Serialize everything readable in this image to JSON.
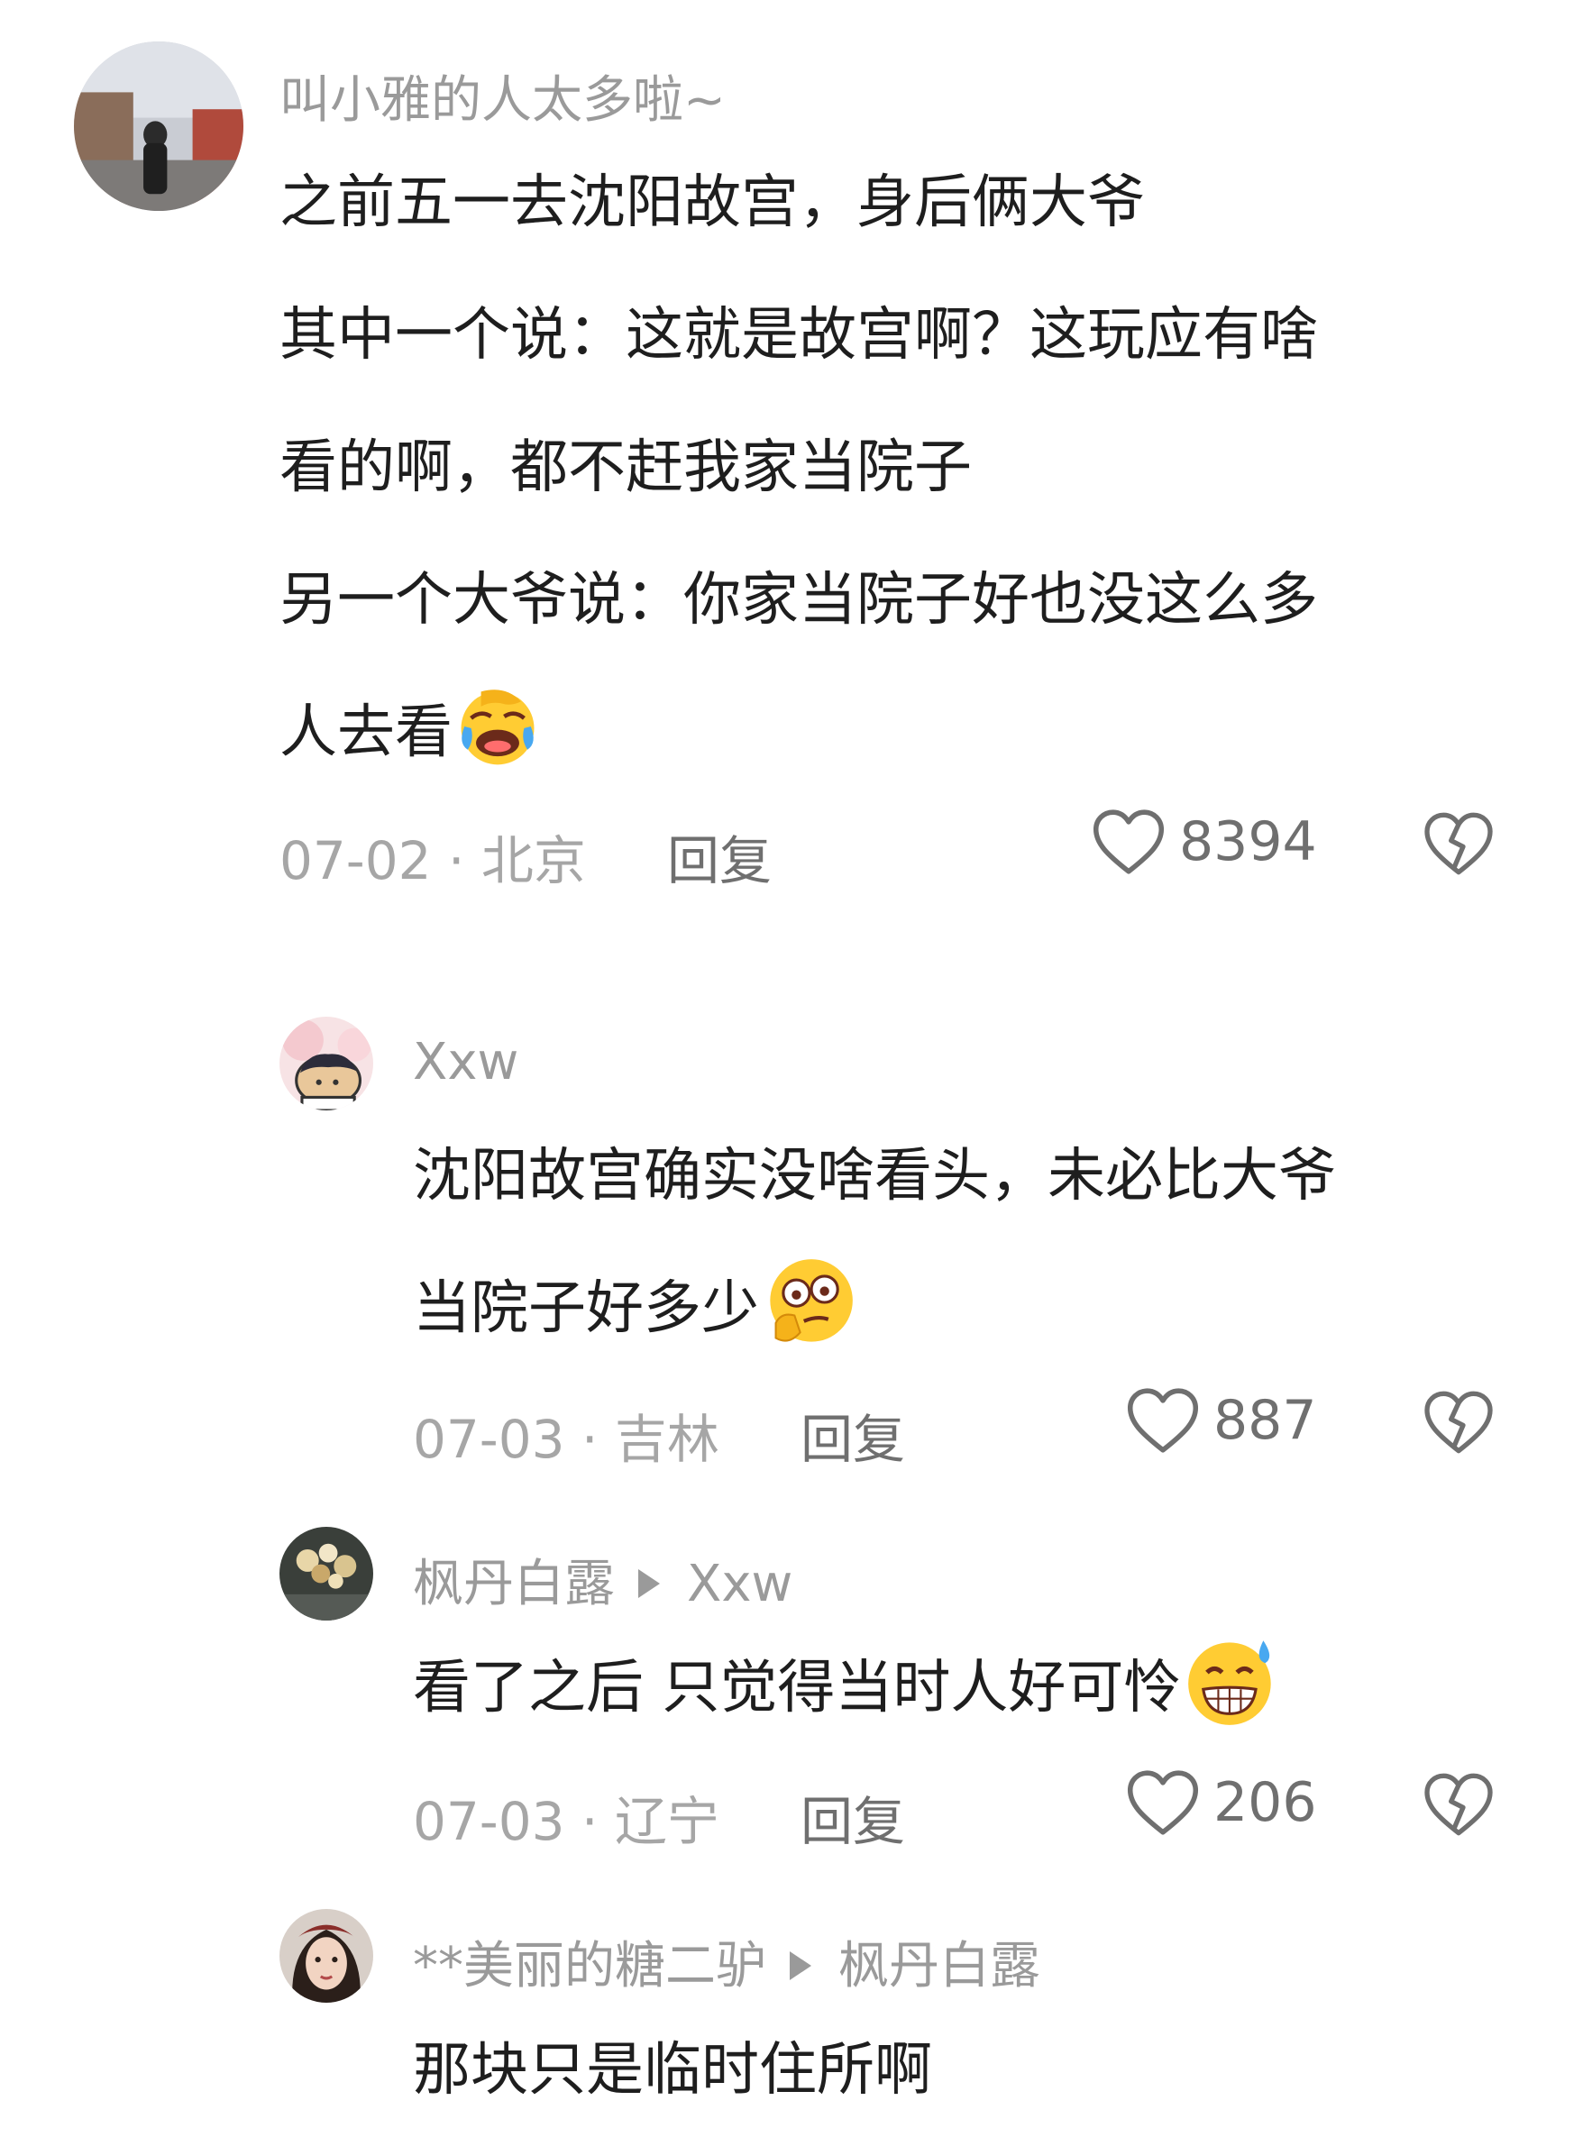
{
  "comments": [
    {
      "user": "叫小雅的人太多啦~",
      "lines": [
        "之前五一去沈阳故宫，身后俩大爷",
        "其中一个说：这就是故宫啊？这玩应有啥",
        "看的啊，都不赶我家当院子",
        "另一个大爷说：你家当院子好也没这么多",
        "人去看"
      ],
      "emoji": "face-with-hand-over-eyes-laughing",
      "date": "07-02",
      "location": "北京",
      "reply_label": "回复",
      "likes": "8394"
    },
    {
      "user": "Xxw",
      "lines": [
        "沈阳故宫确实没啥看头，未必比大爷",
        "当院子好多少"
      ],
      "emoji": "thinking-face-with-wide-eyes",
      "date": "07-03",
      "location": "吉林",
      "reply_label": "回复",
      "likes": "887"
    },
    {
      "user": "枫丹白露",
      "reply_to": "Xxw",
      "lines": [
        "看了之后 只觉得当时人好可怜"
      ],
      "emoji": "grinning-face-with-sweat",
      "date": "07-03",
      "location": "辽宁",
      "reply_label": "回复",
      "likes": "206"
    },
    {
      "user": "**美丽的糖二驴",
      "reply_to": "枫丹白露",
      "lines": [
        "那块只是临时住所啊"
      ]
    }
  ],
  "meta_separator": " · ",
  "colors": {
    "username": "#9a9a9a",
    "body": "#1e1e1e",
    "meta": "#a6a6a6",
    "action": "#6f6f6f"
  }
}
